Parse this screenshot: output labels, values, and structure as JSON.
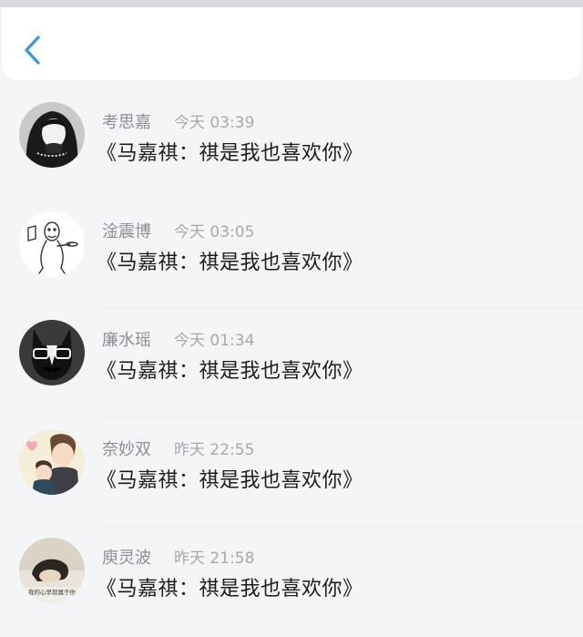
{
  "colors": {
    "accent": "#3a97e0",
    "background": "#f4f5f7"
  },
  "header": {
    "back_icon": "chevron-left-icon"
  },
  "messages": [
    {
      "name": "考思嘉",
      "time": "今天 03:39",
      "text": "《马嘉祺：祺是我也喜欢你》"
    },
    {
      "name": "淦震博",
      "time": "今天 03:05",
      "text": "《马嘉祺：祺是我也喜欢你》"
    },
    {
      "name": "廉水瑶",
      "time": "今天 01:34",
      "text": "《马嘉祺：祺是我也喜欢你》"
    },
    {
      "name": "奈妙双",
      "time": "昨天 22:55",
      "text": "《马嘉祺：祺是我也喜欢你》"
    },
    {
      "name": "庾灵波",
      "time": "昨天 21:58",
      "text": "《马嘉祺：祺是我也喜欢你》",
      "avatar_caption": "我的心早就属于你"
    }
  ]
}
